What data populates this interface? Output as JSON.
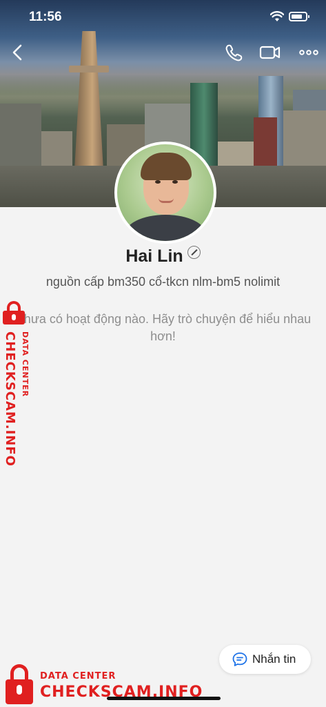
{
  "status_bar": {
    "time": "11:56"
  },
  "profile": {
    "name": "Hai Lin",
    "bio": "nguồn cấp bm350 cổ-tkcn nlm-bm5 nolimit",
    "empty_state": "Chưa có hoạt động nào. Hãy trò chuyện để hiểu nhau hơn!"
  },
  "nav": {
    "back_icon": "chevron-left-icon",
    "call_icon": "phone-icon",
    "video_icon": "video-camera-icon",
    "more_icon": "more-horizontal-icon"
  },
  "actions": {
    "message_label": "Nhắn tin"
  },
  "watermark": {
    "small": "DATA CENTER",
    "big": "CHECKSCAM.INFO",
    "color": "#e02020"
  }
}
